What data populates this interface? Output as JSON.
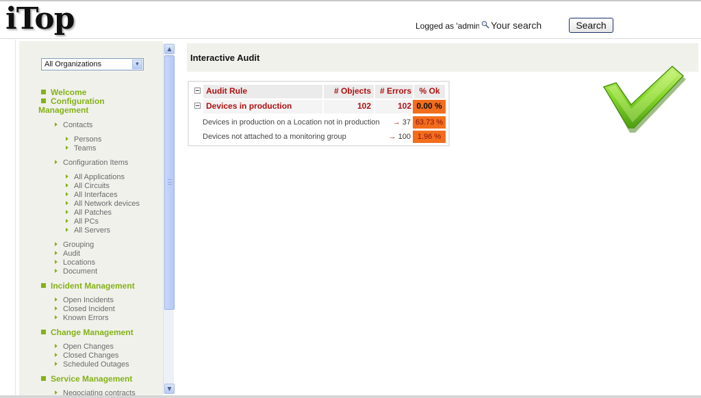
{
  "header": {
    "logo": "iTop",
    "logged_as": "Logged as 'admin'",
    "search_placeholder": "Your search",
    "search_button": "Search"
  },
  "menu": {
    "org_select": "All Organizations",
    "welcome": "Welcome",
    "config_mgmt": "Configuration Management",
    "contacts": "Contacts",
    "persons": "Persons",
    "teams": "Teams",
    "config_items": "Configuration Items",
    "all_applications": "All Applications",
    "all_circuits": "All Circuits",
    "all_interfaces": "All Interfaces",
    "all_network_devices": "All Network devices",
    "all_patches": "All Patches",
    "all_pcs": "All PCs",
    "all_servers": "All Servers",
    "grouping": "Grouping",
    "audit": "Audit",
    "locations": "Locations",
    "document": "Document",
    "incident_mgmt": "Incident Management",
    "open_incidents": "Open Incidents",
    "closed_incident": "Closed Incident",
    "known_errors": "Known Errors",
    "change_mgmt": "Change Management",
    "open_changes": "Open Changes",
    "closed_changes": "Closed Changes",
    "scheduled_outages": "Scheduled Outages",
    "service_mgmt": "Service Management",
    "negotiating_contracts": "Negociating contracts"
  },
  "main": {
    "title": "Interactive Audit",
    "table": {
      "col_rule": "Audit Rule",
      "col_objects": "# Objects",
      "col_errors": "# Errors",
      "col_ok": "% Ok",
      "group_name": "Devices in production",
      "group_objects": "102",
      "group_errors": "102",
      "group_ok": "0.00 %",
      "rules": [
        {
          "name": "Devices in production on a Location not in production",
          "errors": "37",
          "ok": "63.73 %"
        },
        {
          "name": "Devices not attached to a monitoring group",
          "errors": "100",
          "ok": "1.96 %"
        }
      ]
    }
  },
  "colors": {
    "menu_green": "#83b217",
    "error_red": "#b01010",
    "ok_orange": "#f26d1c"
  }
}
